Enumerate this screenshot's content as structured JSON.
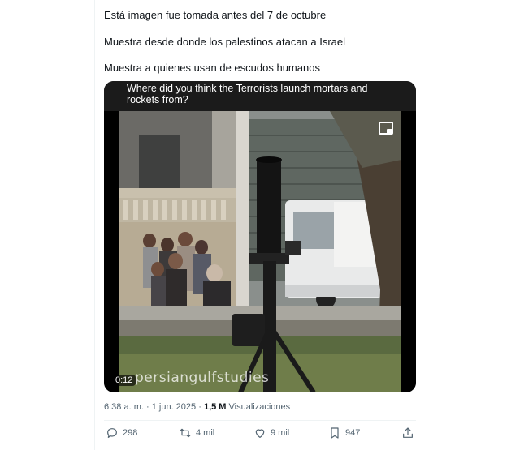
{
  "tweet": {
    "lines": [
      "Está imagen fue tomada antes del 7 de octubre",
      "Muestra desde donde los palestinos atacan a Israel",
      "Muestra a quienes usan de escudos humanos"
    ],
    "video": {
      "caption": "Where did you think the Terrorists launch mortars and rockets from?",
      "duration": "0:12",
      "watermark": "persiangulfstudies",
      "pip_icon": "picture-in-picture-icon"
    },
    "meta": {
      "time": "6:38 a. m.",
      "separator": "·",
      "date": "1 jun. 2025",
      "views_count": "1,5 M",
      "views_label": "Visualizaciones"
    },
    "actions": {
      "replies": "298",
      "reposts": "4 mil",
      "likes": "9 mil",
      "bookmarks": "947"
    }
  },
  "colors": {
    "text": "#0f1419",
    "secondary": "#536471",
    "border": "#eff3f4"
  }
}
